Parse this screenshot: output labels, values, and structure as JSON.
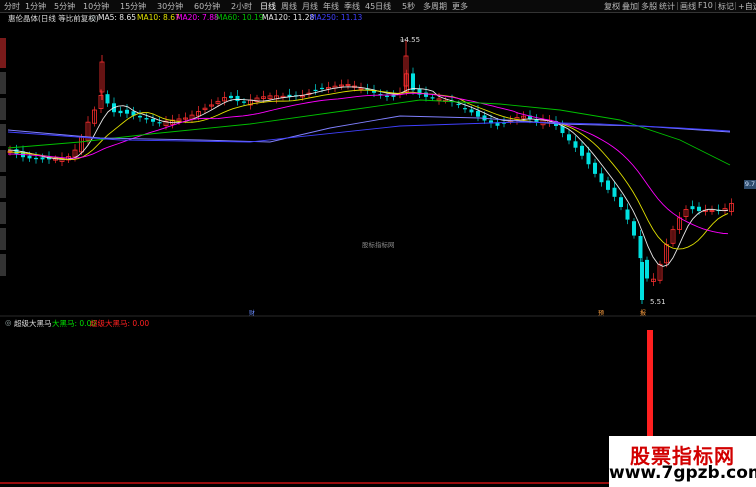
{
  "toolbar": {
    "periods": [
      "分时",
      "1分钟",
      "5分钟",
      "10分钟",
      "15分钟",
      "30分钟",
      "60分钟",
      "2小时",
      "日线",
      "周线",
      "月线",
      "年线",
      "季线",
      "45日线",
      "5秒",
      "多周期",
      "更多"
    ],
    "active_period": "日线",
    "right_buttons": [
      "复权",
      "叠加",
      "多股",
      "统计",
      "画线",
      "F10",
      "标记",
      "+自选"
    ]
  },
  "main_legend": {
    "title": "惠伦晶体(日线 等比前复权)",
    "ma5": "MA5: 8.65",
    "ma10": "MA10: 8.67",
    "ma20": "MA20: 7.88",
    "ma60": "MA60: 10.19",
    "ma120": "MA120: 11.28",
    "ma250": "MA250: 11.13"
  },
  "sub_legend": {
    "title": "超级大黑马",
    "field1": "大黑马: 0.00",
    "field2": "超级大黑马: 0.00"
  },
  "annotations": {
    "high_price": "14.55",
    "low_price": "5.51",
    "right_price": "9.7",
    "watermark_center": "股标指标网",
    "mark_cai": "财",
    "mark_yu": "预",
    "mark_bao": "报"
  },
  "watermark": {
    "line1": "股票指标网",
    "line2": "www.7gpzb.com"
  },
  "colors": {
    "up": "#ff3030",
    "down": "#00e0e0",
    "ma5": "#e8e8e8",
    "ma10": "#e0e000",
    "ma20": "#ff00ff",
    "ma60": "#00c000",
    "ma120": "#8080ff",
    "ma250": "#4040ff",
    "signal": "#ff2020"
  },
  "chart_data": {
    "type": "candlestick",
    "price_high": 14.55,
    "price_low": 5.51,
    "signal_bars": [
      {
        "index": 108,
        "value": 1
      }
    ]
  }
}
